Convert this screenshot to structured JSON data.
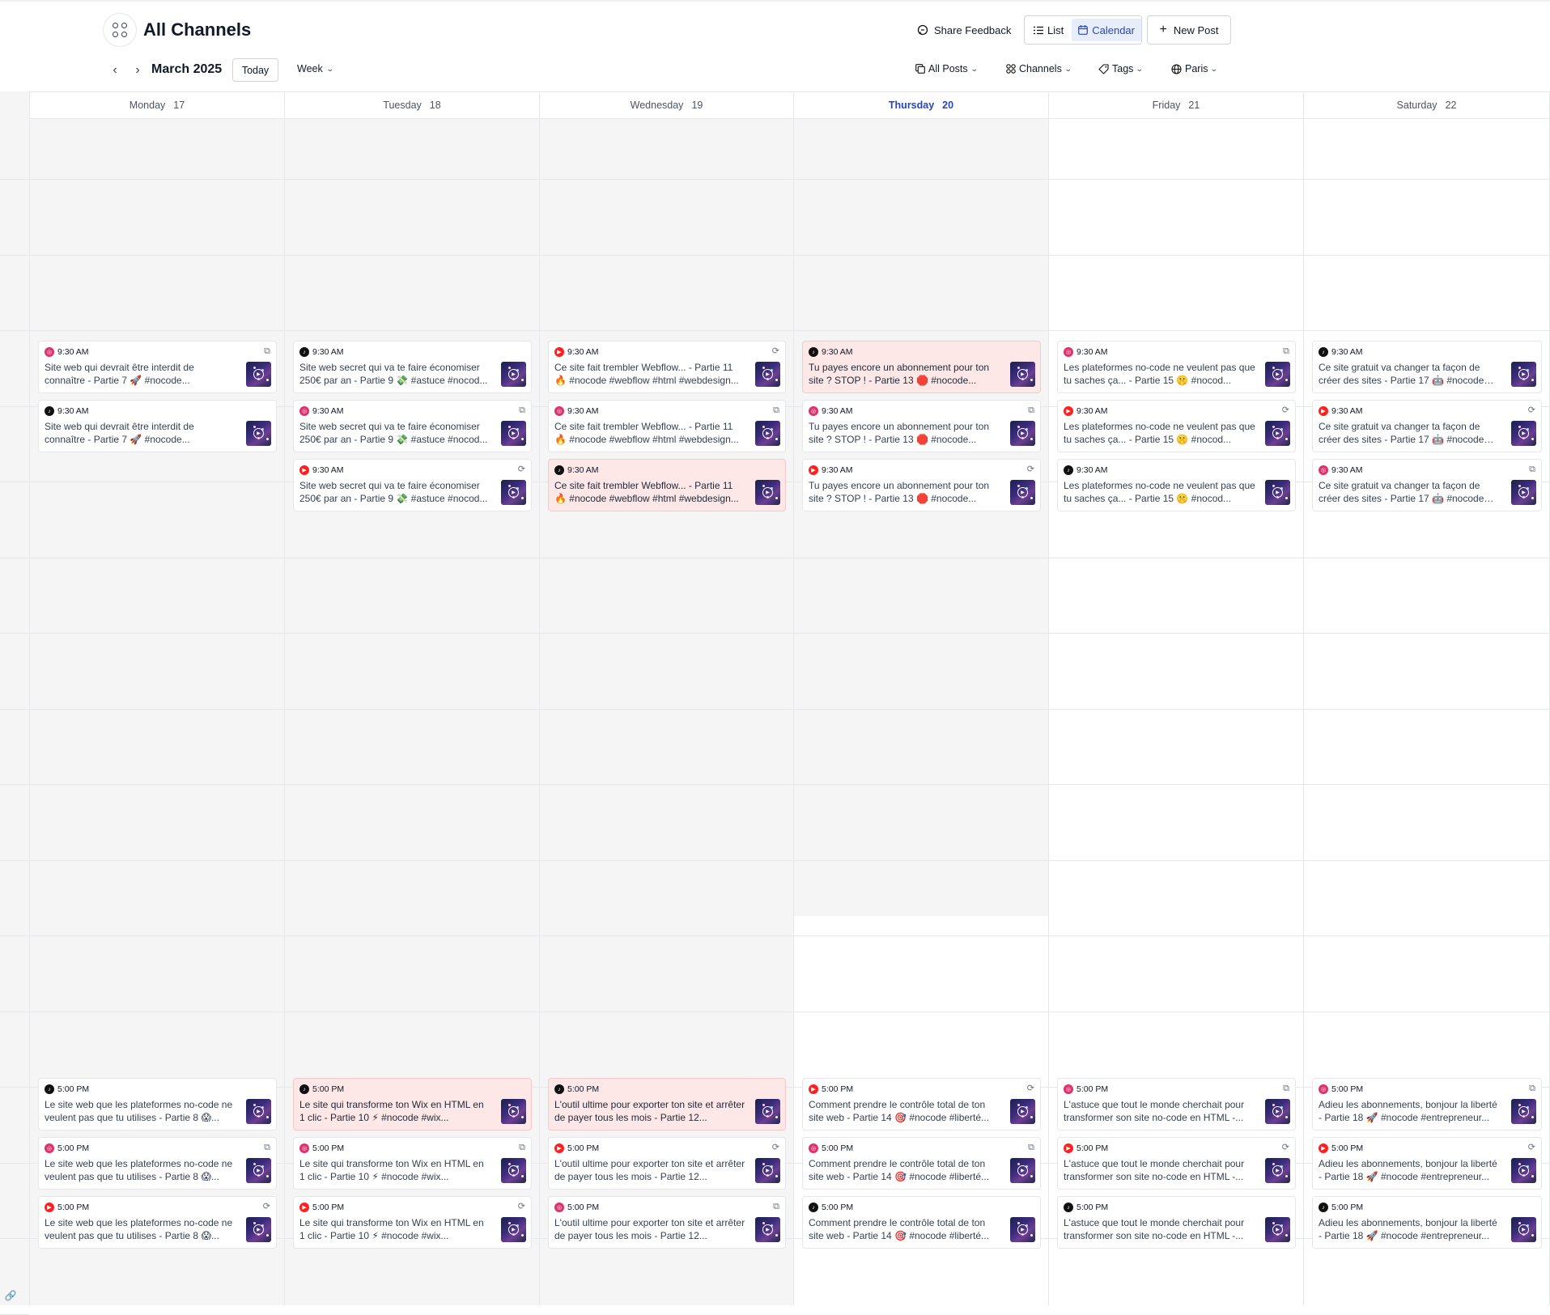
{
  "header": {
    "title": "All Channels",
    "share_feedback": "Share Feedback",
    "view_list": "List",
    "view_calendar": "Calendar",
    "new_post": "New Post",
    "month": "March 2025",
    "today": "Today",
    "range": "Week",
    "filters": {
      "posts": "All Posts",
      "channels": "Channels",
      "tags": "Tags",
      "timezone": "Paris"
    }
  },
  "accent_color": "#2646b8",
  "days": [
    {
      "name": "Monday",
      "num": "17",
      "is_today": false
    },
    {
      "name": "Tuesday",
      "num": "18",
      "is_today": false
    },
    {
      "name": "Wednesday",
      "num": "19",
      "is_today": false
    },
    {
      "name": "Thursday",
      "num": "20",
      "is_today": true
    },
    {
      "name": "Friday",
      "num": "21",
      "is_today": false
    },
    {
      "name": "Saturday",
      "num": "22",
      "is_today": false
    }
  ],
  "posts": {
    "morning": [
      [
        {
          "time": "9:30 AM",
          "channel": "instagram",
          "type": "reel-icon",
          "failed": false,
          "text": "Site web qui devrait être interdit de connaître - Partie 7 🚀 #nocode..."
        },
        {
          "time": "9:30 AM",
          "channel": "tiktok",
          "type": "",
          "failed": false,
          "text": "Site web qui devrait être interdit de connaître - Partie 7 🚀 #nocode..."
        }
      ],
      [
        {
          "time": "9:30 AM",
          "channel": "tiktok",
          "type": "",
          "failed": false,
          "text": "Site web secret qui va te faire économiser 250€ par an - Partie 9 💸 #astuce #nocod..."
        },
        {
          "time": "9:30 AM",
          "channel": "instagram",
          "type": "reel-icon",
          "failed": false,
          "text": "Site web secret qui va te faire économiser 250€ par an - Partie 9 💸 #astuce #nocod..."
        },
        {
          "time": "9:30 AM",
          "channel": "youtube",
          "type": "shorts-icon",
          "failed": false,
          "text": "Site web secret qui va te faire économiser 250€ par an - Partie 9 💸 #astuce #nocod..."
        }
      ],
      [
        {
          "time": "9:30 AM",
          "channel": "youtube",
          "type": "shorts-icon",
          "failed": false,
          "text": "Ce site fait trembler Webflow... - Partie 11 🔥 #nocode #webflow #html #webdesign..."
        },
        {
          "time": "9:30 AM",
          "channel": "instagram",
          "type": "reel-icon",
          "failed": false,
          "text": "Ce site fait trembler Webflow... - Partie 11 🔥 #nocode #webflow #html #webdesign..."
        },
        {
          "time": "9:30 AM",
          "channel": "tiktok",
          "type": "",
          "failed": true,
          "text": "Ce site fait trembler Webflow... - Partie 11 🔥 #nocode #webflow #html #webdesign..."
        }
      ],
      [
        {
          "time": "9:30 AM",
          "channel": "tiktok",
          "type": "",
          "failed": true,
          "text": "Tu payes encore un abonnement pour ton site ? STOP ! - Partie 13 🛑 #nocode..."
        },
        {
          "time": "9:30 AM",
          "channel": "instagram",
          "type": "reel-icon",
          "failed": false,
          "text": "Tu payes encore un abonnement pour ton site ? STOP ! - Partie 13 🛑 #nocode..."
        },
        {
          "time": "9:30 AM",
          "channel": "youtube",
          "type": "shorts-icon",
          "failed": false,
          "text": "Tu payes encore un abonnement pour ton site ? STOP ! - Partie 13 🛑 #nocode..."
        }
      ],
      [
        {
          "time": "9:30 AM",
          "channel": "instagram",
          "type": "reel-icon",
          "failed": false,
          "text": "Les plateformes no-code ne veulent pas que tu saches ça... - Partie 15 🤫 #nocod..."
        },
        {
          "time": "9:30 AM",
          "channel": "youtube",
          "type": "shorts-icon",
          "failed": false,
          "text": "Les plateformes no-code ne veulent pas que tu saches ça... - Partie 15 🤫 #nocod..."
        },
        {
          "time": "9:30 AM",
          "channel": "tiktok",
          "type": "",
          "failed": false,
          "text": "Les plateformes no-code ne veulent pas que tu saches ça... - Partie 15 🤫 #nocod..."
        }
      ],
      [
        {
          "time": "9:30 AM",
          "channel": "tiktok",
          "type": "",
          "failed": false,
          "text": "Ce site gratuit va changer ta façon de créer des sites - Partie 17 🤖 #nocode #outil..."
        },
        {
          "time": "9:30 AM",
          "channel": "youtube",
          "type": "shorts-icon",
          "failed": false,
          "text": "Ce site gratuit va changer ta façon de créer des sites - Partie 17 🤖 #nocode #outil..."
        },
        {
          "time": "9:30 AM",
          "channel": "instagram",
          "type": "reel-icon",
          "failed": false,
          "text": "Ce site gratuit va changer ta façon de créer des sites - Partie 17 🤖 #nocode #outil..."
        }
      ]
    ],
    "evening": [
      [
        {
          "time": "5:00 PM",
          "channel": "tiktok",
          "type": "",
          "failed": false,
          "text": "Le site web que les plateformes no-code ne veulent pas que tu utilises - Partie 8 😱..."
        },
        {
          "time": "5:00 PM",
          "channel": "instagram",
          "type": "reel-icon",
          "failed": false,
          "text": "Le site web que les plateformes no-code ne veulent pas que tu utilises - Partie 8 😱..."
        },
        {
          "time": "5:00 PM",
          "channel": "youtube",
          "type": "shorts-icon",
          "failed": false,
          "text": "Le site web que les plateformes no-code ne veulent pas que tu utilises - Partie 8 😱..."
        }
      ],
      [
        {
          "time": "5:00 PM",
          "channel": "tiktok",
          "type": "",
          "failed": true,
          "text": "Le site qui transforme ton Wix en HTML en 1 clic - Partie 10 ⚡ #nocode #wix..."
        },
        {
          "time": "5:00 PM",
          "channel": "instagram",
          "type": "reel-icon",
          "failed": false,
          "text": "Le site qui transforme ton Wix en HTML en 1 clic - Partie 10 ⚡ #nocode #wix..."
        },
        {
          "time": "5:00 PM",
          "channel": "youtube",
          "type": "shorts-icon",
          "failed": false,
          "text": "Le site qui transforme ton Wix en HTML en 1 clic - Partie 10 ⚡ #nocode #wix..."
        }
      ],
      [
        {
          "time": "5:00 PM",
          "channel": "tiktok",
          "type": "",
          "failed": true,
          "text": "L'outil ultime pour exporter ton site et arrêter de payer tous les mois - Partie 12..."
        },
        {
          "time": "5:00 PM",
          "channel": "youtube",
          "type": "shorts-icon",
          "failed": false,
          "text": "L'outil ultime pour exporter ton site et arrêter de payer tous les mois - Partie 12..."
        },
        {
          "time": "5:00 PM",
          "channel": "instagram",
          "type": "reel-icon",
          "failed": false,
          "text": "L'outil ultime pour exporter ton site et arrêter de payer tous les mois - Partie 12..."
        }
      ],
      [
        {
          "time": "5:00 PM",
          "channel": "youtube",
          "type": "shorts-icon",
          "failed": false,
          "text": "Comment prendre le contrôle total de ton site web - Partie 14 🎯 #nocode #liberté..."
        },
        {
          "time": "5:00 PM",
          "channel": "instagram",
          "type": "reel-icon",
          "failed": false,
          "text": "Comment prendre le contrôle total de ton site web - Partie 14 🎯 #nocode #liberté..."
        },
        {
          "time": "5:00 PM",
          "channel": "tiktok",
          "type": "",
          "failed": false,
          "text": "Comment prendre le contrôle total de ton site web - Partie 14 🎯 #nocode #liberté..."
        }
      ],
      [
        {
          "time": "5:00 PM",
          "channel": "instagram",
          "type": "reel-icon",
          "failed": false,
          "text": "L'astuce que tout le monde cherchait pour transformer son site no-code en HTML -..."
        },
        {
          "time": "5:00 PM",
          "channel": "youtube",
          "type": "shorts-icon",
          "failed": false,
          "text": "L'astuce que tout le monde cherchait pour transformer son site no-code en HTML -..."
        },
        {
          "time": "5:00 PM",
          "channel": "tiktok",
          "type": "",
          "failed": false,
          "text": "L'astuce que tout le monde cherchait pour transformer son site no-code en HTML -..."
        }
      ],
      [
        {
          "time": "5:00 PM",
          "channel": "instagram",
          "type": "reel-icon",
          "failed": false,
          "text": "Adieu les abonnements, bonjour la liberté - Partie 18 🚀 #nocode #entrepreneur..."
        },
        {
          "time": "5:00 PM",
          "channel": "youtube",
          "type": "shorts-icon",
          "failed": false,
          "text": "Adieu les abonnements, bonjour la liberté - Partie 18 🚀 #nocode #entrepreneur..."
        },
        {
          "time": "5:00 PM",
          "channel": "tiktok",
          "type": "",
          "failed": false,
          "text": "Adieu les abonnements, bonjour la liberté - Partie 18 🚀 #nocode #entrepreneur..."
        }
      ]
    ]
  }
}
